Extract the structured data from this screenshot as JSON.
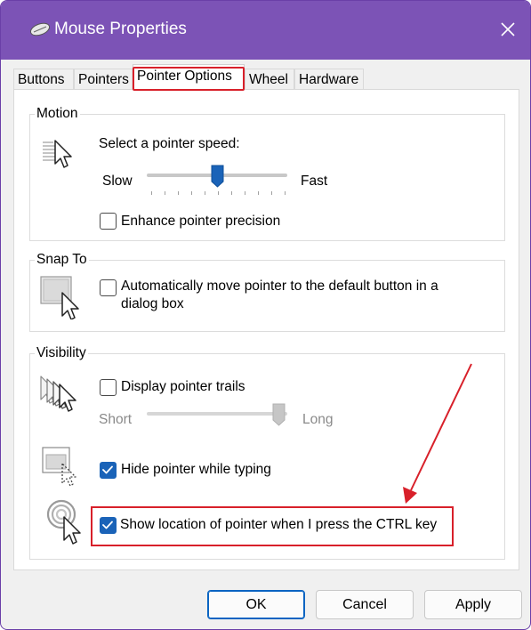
{
  "window": {
    "title": "Mouse Properties",
    "accent": "#7c53b6",
    "close_icon": "close-icon"
  },
  "tabs": [
    {
      "label": "Buttons",
      "active": false
    },
    {
      "label": "Pointers",
      "active": false
    },
    {
      "label": "Pointer Options",
      "active": true
    },
    {
      "label": "Wheel",
      "active": false
    },
    {
      "label": "Hardware",
      "active": false
    }
  ],
  "motion": {
    "group_label": "Motion",
    "speed_label": "Select a pointer speed:",
    "slow_label": "Slow",
    "fast_label": "Fast",
    "speed_level": 0.5,
    "enhance_label": "Enhance pointer precision",
    "enhance_checked": false
  },
  "snap_to": {
    "group_label": "Snap To",
    "auto_move_label_line1": "Automatically move pointer to the default button in a",
    "auto_move_label_line2": "dialog box",
    "auto_move_checked": false
  },
  "visibility": {
    "group_label": "Visibility",
    "trails_label": "Display pointer trails",
    "trails_checked": false,
    "short_label": "Short",
    "long_label": "Long",
    "trails_level": 1.0,
    "hide_label": "Hide pointer while typing",
    "hide_checked": true,
    "show_location_label": "Show location of pointer when I press the CTRL key",
    "show_location_checked": true
  },
  "buttons": {
    "ok": "OK",
    "cancel": "Cancel",
    "apply": "Apply"
  },
  "annotation_color": "#d8202a"
}
